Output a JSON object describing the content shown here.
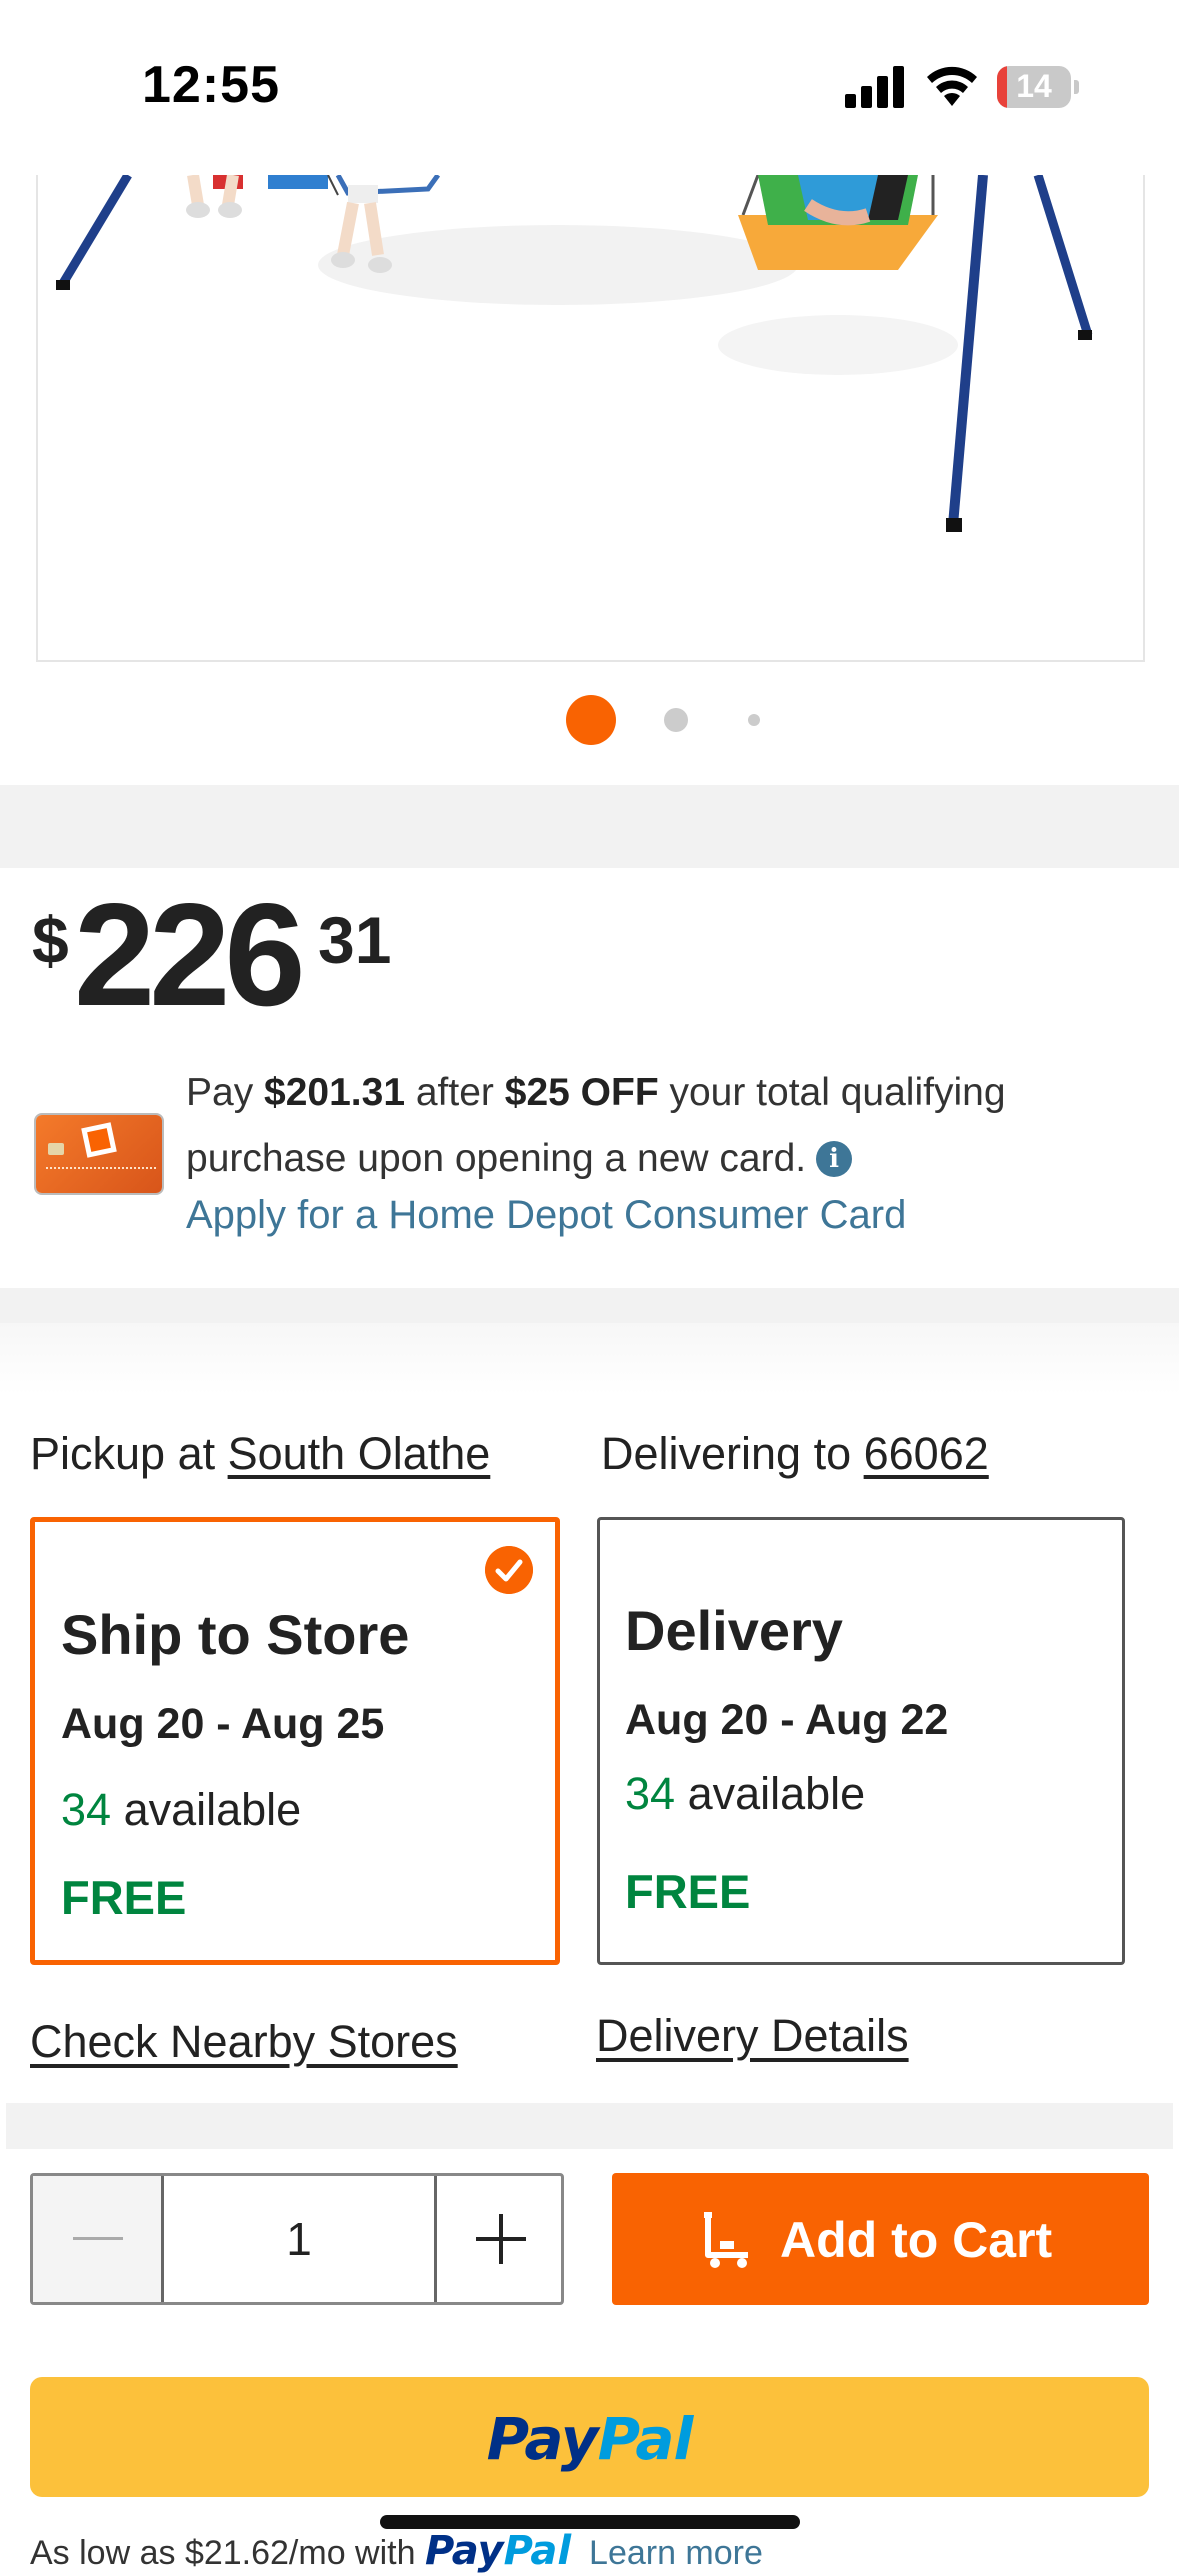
{
  "status_bar": {
    "time": "12:55",
    "battery_level": "14",
    "icons": [
      "signal-icon",
      "wifi-icon",
      "battery-icon"
    ]
  },
  "carousel": {
    "dot_count": 3,
    "active_index": 0
  },
  "price": {
    "currency": "$",
    "dollars": "226",
    "cents": "31"
  },
  "card_promo": {
    "text_pay": "Pay ",
    "promo_price": "$201.31",
    "text_after": " after ",
    "discount": "$25 OFF",
    "text_rest": " your total qualifying purchase upon opening a new card.",
    "info_icon_char": "i",
    "apply_link": "Apply for a Home Depot Consumer Card"
  },
  "fulfillment": {
    "pickup_prefix": "Pickup at ",
    "pickup_store": "South Olathe",
    "delivery_prefix": "Delivering to ",
    "delivery_zip": "66062",
    "ship_to_store": {
      "title": "Ship to Store",
      "dates": "Aug 20 - Aug 25",
      "available_count": "34",
      "available_label": " available",
      "price": "FREE",
      "selected": true
    },
    "delivery": {
      "title": "Delivery",
      "dates": "Aug 20 - Aug 22",
      "available_count": "34",
      "available_label": " available",
      "price": "FREE",
      "selected": false
    },
    "check_nearby_link": "Check Nearby Stores",
    "delivery_details_link": "Delivery Details"
  },
  "purchase": {
    "quantity": "1",
    "add_to_cart_label": "Add to Cart"
  },
  "paypal": {
    "logo_pay": "Pay",
    "logo_pal": "Pal",
    "as_low_text": "As low as $21.62/mo with ",
    "learn_more": "Learn more"
  },
  "colors": {
    "brand_orange": "#f96302",
    "green": "#00853f",
    "link_blue": "#3e7697",
    "paypal_yellow": "#fcc13b"
  }
}
